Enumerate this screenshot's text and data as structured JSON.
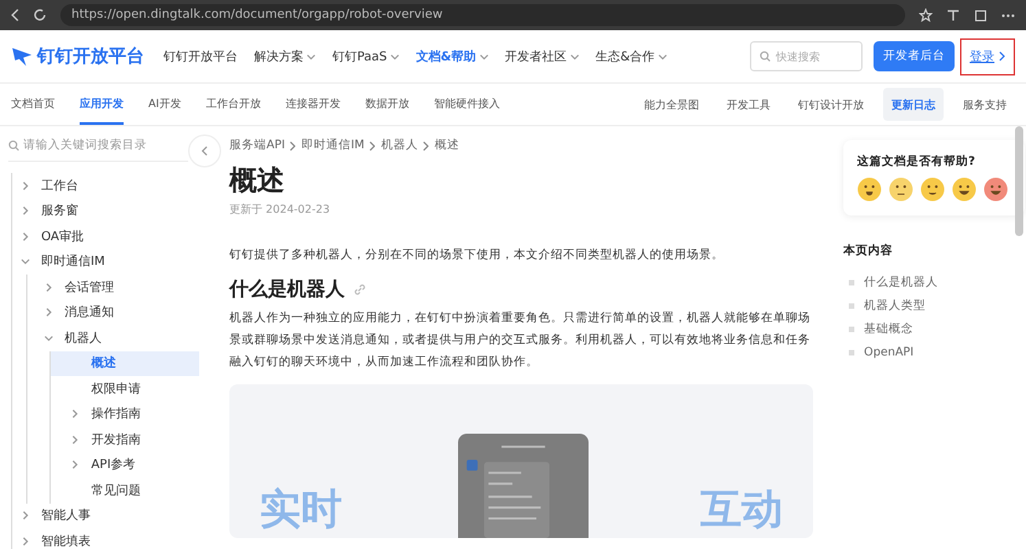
{
  "browser": {
    "url": "https://open.dingtalk.com/document/orgapp/robot-overview"
  },
  "header": {
    "logo": "钉钉开放平台",
    "nav": [
      {
        "label": "钉钉开放平台",
        "selected": false,
        "dropdown": false
      },
      {
        "label": "解决方案",
        "selected": false,
        "dropdown": true
      },
      {
        "label": "钉钉PaaS",
        "selected": false,
        "dropdown": true
      },
      {
        "label": "文档&帮助",
        "selected": true,
        "dropdown": true
      },
      {
        "label": "开发者社区",
        "selected": false,
        "dropdown": true
      },
      {
        "label": "生态&合作",
        "selected": false,
        "dropdown": true
      }
    ],
    "search": {
      "placeholder": "快速搜索"
    },
    "console_button": "开发者后台",
    "login": "登录"
  },
  "subnav": {
    "left": [
      {
        "label": "文档首页",
        "selected": false
      },
      {
        "label": "应用开发",
        "selected": true
      },
      {
        "label": "AI开发",
        "selected": false
      },
      {
        "label": "工作台开放",
        "selected": false
      },
      {
        "label": "连接器开发",
        "selected": false
      },
      {
        "label": "数据开放",
        "selected": false
      },
      {
        "label": "智能硬件接入",
        "selected": false
      }
    ],
    "right": [
      {
        "label": "能力全景图",
        "selected": false
      },
      {
        "label": "开发工具",
        "selected": false
      },
      {
        "label": "钉钉设计开放",
        "selected": false
      },
      {
        "label": "更新日志",
        "selected": true
      },
      {
        "label": "服务支持",
        "selected": false
      }
    ]
  },
  "sidebar": {
    "search": {
      "placeholder": "请输入关键词搜索目录"
    },
    "tree": [
      {
        "label": "工作台",
        "expanded": false,
        "selected": false
      },
      {
        "label": "服务窗",
        "expanded": false,
        "selected": false
      },
      {
        "label": "OA审批",
        "expanded": false,
        "selected": false
      },
      {
        "label": "即时通信IM",
        "expanded": true,
        "selected": false,
        "children": [
          {
            "label": "会话管理",
            "expanded": false,
            "selected": false
          },
          {
            "label": "消息通知",
            "expanded": false,
            "selected": false
          },
          {
            "label": "机器人",
            "expanded": true,
            "selected": false,
            "children": [
              {
                "label": "概述",
                "selected": true
              },
              {
                "label": "权限申请",
                "selected": false
              },
              {
                "label": "操作指南",
                "expanded": false,
                "selected": false
              },
              {
                "label": "开发指南",
                "expanded": false,
                "selected": false
              },
              {
                "label": "API参考",
                "expanded": false,
                "selected": false
              },
              {
                "label": "常见问题",
                "selected": false
              }
            ]
          }
        ]
      },
      {
        "label": "智能人事",
        "expanded": false,
        "selected": false
      },
      {
        "label": "智能填表",
        "expanded": false,
        "selected": false
      }
    ]
  },
  "article": {
    "breadcrumb": [
      "服务端API",
      "即时通信IM",
      "机器人",
      "概述"
    ],
    "title": "概述",
    "updated": "更新于 2024-02-23",
    "intro": "钉钉提供了多种机器人，分别在不同的场景下使用，本文介绍不同类型机器人的使用场景。",
    "section_title": "什么是机器人",
    "section_text": "机器人作为一种独立的应用能力，在钉钉中扮演着重要角色。只需进行简单的设置，机器人就能够在单聊场景或群聊场景中发送消息通知，或者提供与用户的交互式服务。利用机器人，可以有效地将业务信息和任务融入钉钉的聊天环境中，从而加速工作流程和团队协作。",
    "banner_words": [
      "实时",
      "互动"
    ]
  },
  "feedback": {
    "question": "这篇文档是否有帮助?"
  },
  "toc": {
    "title": "本页内容",
    "items": [
      "什么是机器人",
      "机器人类型",
      "基础概念",
      "OpenAPI"
    ]
  }
}
